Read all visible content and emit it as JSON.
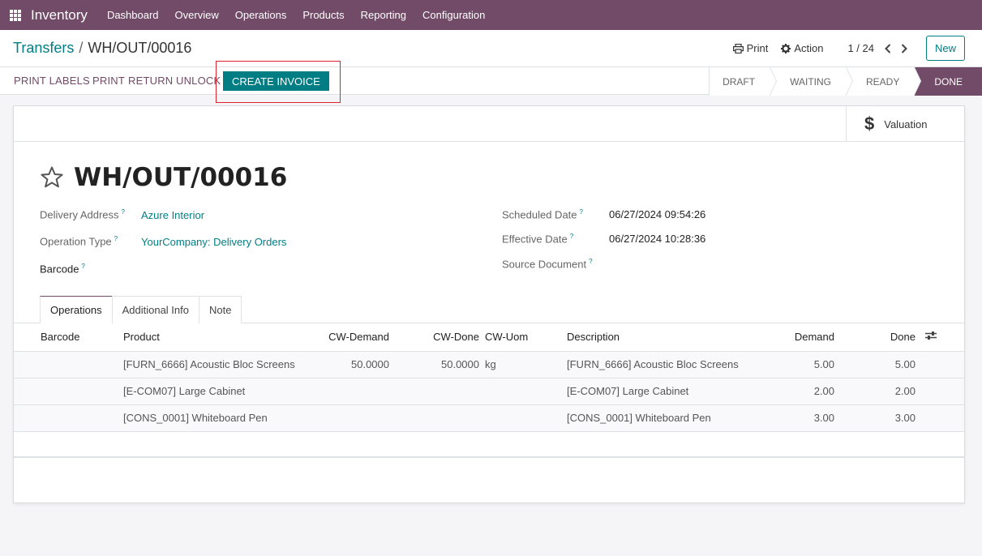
{
  "navbar": {
    "brand": "Inventory",
    "menu": [
      "Dashboard",
      "Overview",
      "Operations",
      "Products",
      "Reporting",
      "Configuration"
    ]
  },
  "breadcrumb": {
    "parent": "Transfers",
    "separator": "/",
    "current": "WH/OUT/00016"
  },
  "control": {
    "print_label": "Print",
    "action_label": "Action",
    "pager": "1 / 24",
    "new_label": "New"
  },
  "actions": {
    "print_labels": "PRINT LABELS",
    "print": "PRINT",
    "return": "RETURN",
    "unlock": "UNLOCK",
    "create_invoice": "CREATE INVOICE"
  },
  "statusbar": {
    "stages": [
      "DRAFT",
      "WAITING",
      "READY",
      "DONE"
    ],
    "current": "DONE"
  },
  "smart_buttons": {
    "valuation_label": "Valuation"
  },
  "record": {
    "title": "WH/OUT/00016",
    "delivery_address_label": "Delivery Address",
    "delivery_address": "Azure Interior",
    "operation_type_label": "Operation Type",
    "operation_type": "YourCompany: Delivery Orders",
    "barcode_label": "Barcode",
    "scheduled_date_label": "Scheduled Date",
    "scheduled_date": "06/27/2024 09:54:26",
    "effective_date_label": "Effective Date",
    "effective_date": "06/27/2024 10:28:36",
    "source_document_label": "Source Document",
    "help_mark": "?"
  },
  "tabs": [
    "Operations",
    "Additional Info",
    "Note"
  ],
  "table": {
    "headers": [
      "Barcode",
      "Product",
      "CW-Demand",
      "CW-Done",
      "CW-Uom",
      "Description",
      "Demand",
      "Done"
    ],
    "rows": [
      [
        "",
        "[FURN_6666] Acoustic Bloc Screens",
        "50.0000",
        "50.0000",
        "kg",
        "[FURN_6666] Acoustic Bloc Screens",
        "5.00",
        "5.00"
      ],
      [
        "",
        "[E-COM07] Large Cabinet",
        "",
        "",
        "",
        "[E-COM07] Large Cabinet",
        "2.00",
        "2.00"
      ],
      [
        "",
        "[CONS_0001] Whiteboard Pen",
        "",
        "",
        "",
        "[CONS_0001] Whiteboard Pen",
        "3.00",
        "3.00"
      ]
    ]
  },
  "colors": {
    "brand": "#714b67",
    "accent": "#017e84",
    "highlight": "#e0202a"
  }
}
